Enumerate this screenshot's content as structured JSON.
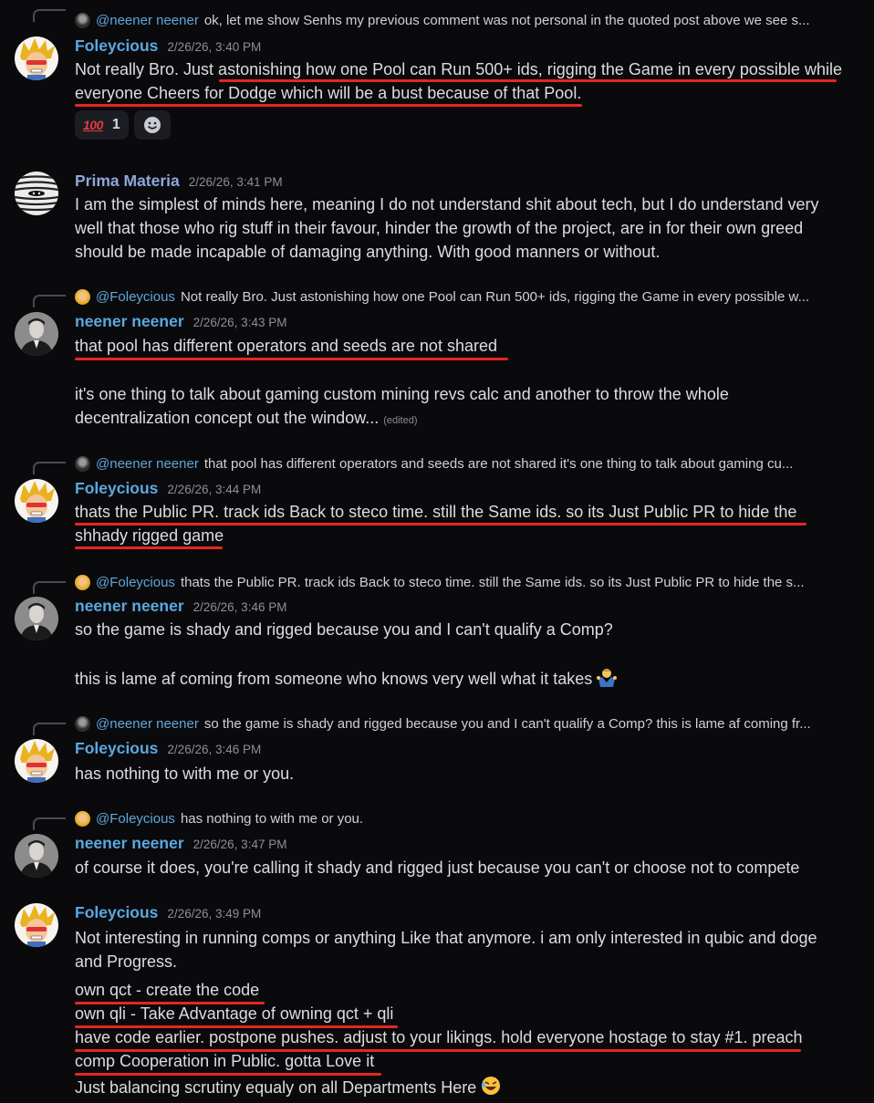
{
  "messages": [
    {
      "reply": {
        "mention": "@neener neener",
        "text": "ok, let me show Senhs my previous comment was not personal  in the quoted post above we see s..."
      },
      "author": "Foleycious",
      "timestamp": "2/26/26, 3:40 PM",
      "lines": [
        "Not really Bro. Just astonishing how one Pool can Run 500+ ids, rigging the Game in every possible while",
        "everyone Cheers for Dodge which will be a bust because of that Pool."
      ],
      "reactions": [
        {
          "emoji": "💯",
          "label": "100",
          "count": "1"
        }
      ]
    },
    {
      "author": "Prima Materia",
      "timestamp": "2/26/26, 3:41 PM",
      "lines": [
        "I am the simplest of minds here, meaning I do not understand shit about tech, but I do understand very",
        "well that those who rig stuff in their favour, hinder the growth of the project, are in for their own greed",
        "should be made incapable of damaging anything. With good manners or without."
      ]
    },
    {
      "reply": {
        "mention": "@Foleycious",
        "text": "Not really Bro. Just astonishing how one Pool can Run 500+ ids, rigging the Game in every possible w..."
      },
      "author": "neener neener",
      "timestamp": "2/26/26, 3:43 PM",
      "lines": [
        "that pool has different operators and seeds are not shared",
        "it's one thing to talk about gaming custom mining revs calc and another to throw the whole",
        "decentralization concept out the window..."
      ],
      "edited": "(edited)"
    },
    {
      "reply": {
        "mention": "@neener neener",
        "text": "that pool has different operators and seeds are not shared  it's one thing to talk about gaming cu..."
      },
      "author": "Foleycious",
      "timestamp": "2/26/26, 3:44 PM",
      "lines": [
        "thats the Public PR. track ids Back to steco time. still the Same ids. so its Just Public PR to hide the",
        "shhady rigged game"
      ]
    },
    {
      "reply": {
        "mention": "@Foleycious",
        "text": "thats the Public PR. track ids Back to steco time. still the Same ids. so its Just Public PR to hide the s..."
      },
      "author": "neener neener",
      "timestamp": "2/26/26, 3:46 PM",
      "lines": [
        "so the game is shady and rigged because you and I can't qualify a Comp?",
        "this is lame af coming from someone who knows very well what it takes"
      ]
    },
    {
      "reply": {
        "mention": "@neener neener",
        "text": "so the game is shady and rigged because you and I can't qualify a Comp?  this is lame af coming fr..."
      },
      "author": "Foleycious",
      "timestamp": "2/26/26, 3:46 PM",
      "lines": [
        "has nothing to with me or you."
      ]
    },
    {
      "reply": {
        "mention": "@Foleycious",
        "text": "has nothing to with me or you."
      },
      "author": "neener neener",
      "timestamp": "2/26/26, 3:47 PM",
      "lines": [
        "of course it does, you're calling it shady and rigged just because you can't or choose not to compete"
      ]
    },
    {
      "author": "Foleycious",
      "timestamp": "2/26/26, 3:49 PM",
      "lines": [
        "Not interesting in running comps or anything Like that anymore. i am only interested in qubic and doge",
        "and Progress.",
        "own qct - create the code",
        "own qli - Take Advantage of owning qct + qli",
        "have code earlier. postpone pushes. adjust to your likings. hold everyone hostage to stay #1. preach",
        "comp Cooperation in Public. gotta Love it",
        "Just balancing scrutiny equaly on all Departments Here"
      ]
    }
  ],
  "colors": {
    "background": "#0a0a0c",
    "author": "#5aa8e0",
    "mention": "#5fa6dc",
    "underline": "#e3281f",
    "timestamp": "#8e8f96"
  }
}
